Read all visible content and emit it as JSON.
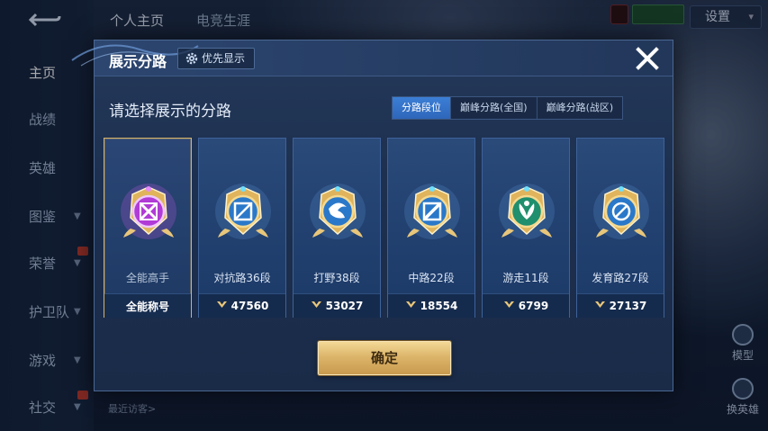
{
  "left_nav": {
    "back_icon": "back-arrow-icon",
    "items": [
      {
        "label": "主页",
        "active": true,
        "has_chevron": false,
        "badge": false
      },
      {
        "label": "战绩",
        "active": false,
        "has_chevron": false,
        "badge": false
      },
      {
        "label": "英雄",
        "active": false,
        "has_chevron": false,
        "badge": false
      },
      {
        "label": "图鉴",
        "active": false,
        "has_chevron": true,
        "badge": false
      },
      {
        "label": "荣誉",
        "active": false,
        "has_chevron": true,
        "badge": true
      },
      {
        "label": "护卫队",
        "active": false,
        "has_chevron": true,
        "badge": false
      },
      {
        "label": "游戏",
        "active": false,
        "has_chevron": true,
        "badge": false
      },
      {
        "label": "社交",
        "active": false,
        "has_chevron": true,
        "badge": true
      }
    ]
  },
  "top_tabs": [
    "个人主页",
    "电竞生涯"
  ],
  "settings_label": "设置",
  "right_side": {
    "model_label": "模型",
    "change_hero_label": "换英雄"
  },
  "bottom_bar": {
    "recent_visitors": "最近访客>"
  },
  "dialog": {
    "title": "展示分路",
    "priority_label": "优先显示",
    "subtitle": "请选择展示的分路",
    "segments": [
      "分路段位",
      "巅峰分路(全国)",
      "巅峰分路(战区)"
    ],
    "active_segment": 0,
    "confirm_label": "确定",
    "cards": [
      {
        "rank": "全能高手",
        "footer": "全能称号",
        "selected": true,
        "icon": "all-round-emblem-icon",
        "show_points": false
      },
      {
        "rank": "对抗路36段",
        "footer": "47560",
        "selected": false,
        "icon": "clash-lane-emblem-icon",
        "show_points": true
      },
      {
        "rank": "打野38段",
        "footer": "53027",
        "selected": false,
        "icon": "jungle-emblem-icon",
        "show_points": true
      },
      {
        "rank": "中路22段",
        "footer": "18554",
        "selected": false,
        "icon": "mid-lane-emblem-icon",
        "show_points": true
      },
      {
        "rank": "游走11段",
        "footer": "6799",
        "selected": false,
        "icon": "roam-emblem-icon",
        "show_points": true
      },
      {
        "rank": "发育路27段",
        "footer": "27137",
        "selected": false,
        "icon": "farm-lane-emblem-icon",
        "show_points": true
      }
    ]
  },
  "colors": {
    "accent_blue": "#2d67bb",
    "gold": "#dcb56a",
    "selected_border": "#d8b36a"
  }
}
